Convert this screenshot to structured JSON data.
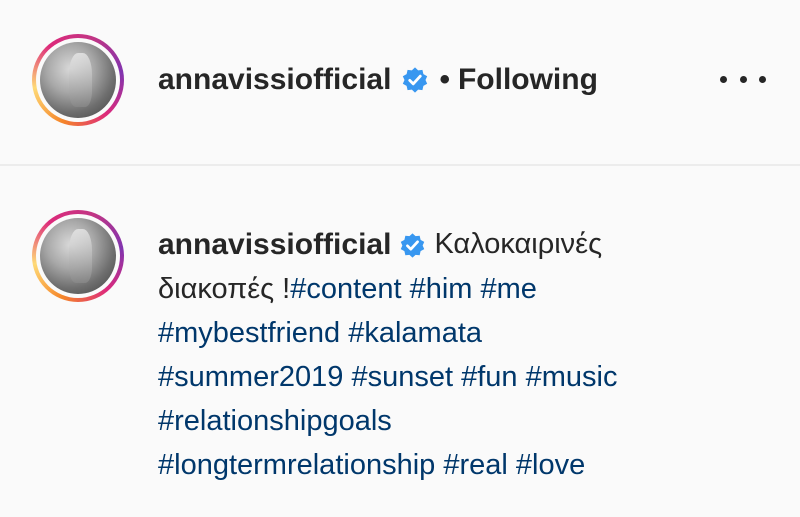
{
  "header": {
    "username": "annavissiofficial",
    "separator": "•",
    "follow_status": "Following",
    "avatar_icon": "profile-avatar",
    "verified_icon": "verified-badge-icon",
    "more_icon": "more-options-icon"
  },
  "comment": {
    "username": "annavissiofficial",
    "text_line1": "Καλοκαιρινές",
    "text_line2": "διακοπές !",
    "line2_tags": [
      "#content",
      "#him",
      "#me"
    ],
    "line3_tags": [
      "#mybestfriend",
      "#kalamata"
    ],
    "line4_tags": [
      "#summer2019",
      "#sunset",
      "#fun",
      "#music"
    ],
    "line5_tags": [
      "#relationshipgoals"
    ],
    "line6_tags": [
      "#longtermrelationship",
      "#real",
      "#love"
    ]
  },
  "colors": {
    "text": "#262626",
    "hashtag": "#00376b",
    "verified": "#3897f0",
    "background": "#fafafa"
  }
}
